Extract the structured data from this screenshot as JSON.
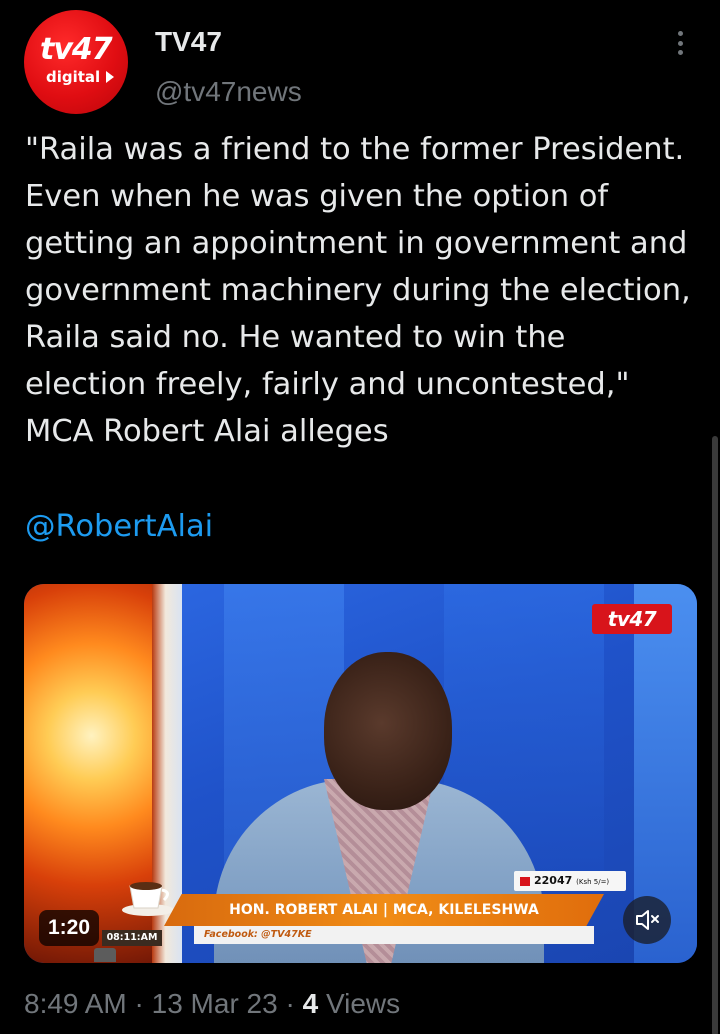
{
  "author": {
    "display_name": "TV47",
    "handle": "@tv47news",
    "avatar_text_main": "tv47",
    "avatar_text_sub": "digital"
  },
  "tweet": {
    "text": "\"Raila was a friend to the former President. Even when he was given the option of getting an appointment in government and government machinery during the election, Raila said no. He wanted to win the election freely, fairly and uncontested,\" MCA Robert Alai alleges",
    "mention": "@RobertAlai"
  },
  "media": {
    "duration": "1:20",
    "channel_logo": "tv47",
    "lower_third": "HON. ROBERT ALAI | MCA, KILELESHWA",
    "lower_third_sub": "Facebook: @TV47KE",
    "clock": "08:11:AM",
    "ticker_value": "22047",
    "ticker_unit": "(Ksh 5/=)",
    "mute_icon": "speaker-muted-icon"
  },
  "meta": {
    "time": "8:49 AM",
    "date": "13 Mar 23",
    "separator": "·",
    "views_count": "4",
    "views_label": "Views"
  },
  "colors": {
    "background": "#000000",
    "text": "#e7e9ea",
    "secondary": "#71767b",
    "link": "#1d9bf0",
    "brand_red": "#d8141b"
  }
}
